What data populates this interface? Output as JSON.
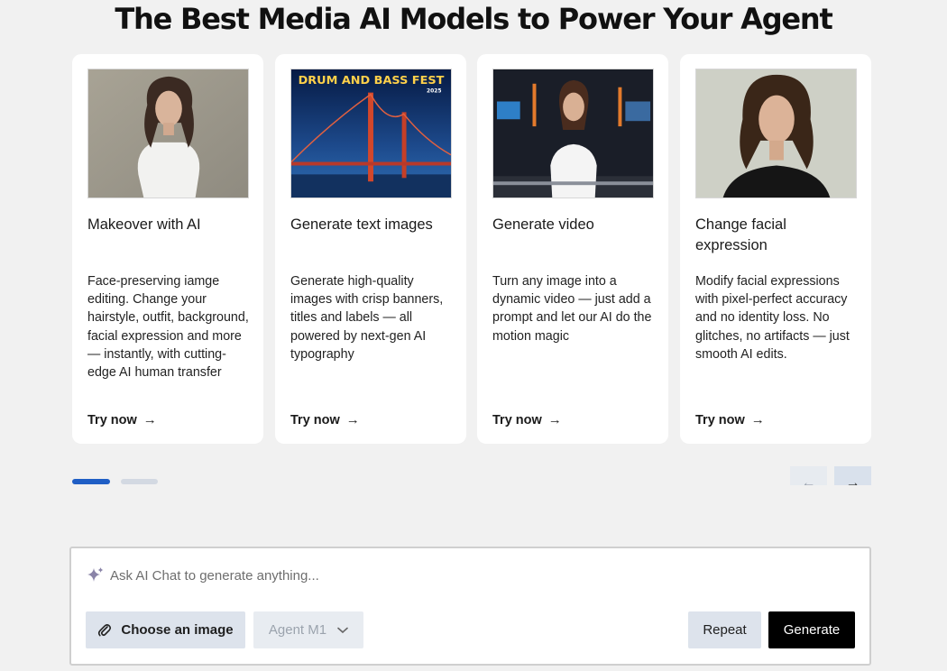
{
  "headline": "The Best Media AI Models to Power Your Agent",
  "cards": [
    {
      "title": "Makeover with AI",
      "description": "Face-preserving iamge editing. Change your hairstyle, outfit, background, facial expression and more — instantly, with cutting-edge AI human transfer",
      "cta": "Try now",
      "image": "woman-white-top-photo"
    },
    {
      "title": "Generate text images",
      "description": "Generate high-quality images with crisp banners, titles and labels — all powered by next-gen AI typography",
      "cta": "Try now",
      "image": "golden-gate-poster",
      "image_text": "DRUM AND BASS FEST",
      "image_subtext": "2025"
    },
    {
      "title": "Generate video",
      "description": "Turn any image into a dynamic video — just add a prompt and let our AI do the motion magic",
      "cta": "Try now",
      "image": "news-anchor-studio-photo"
    },
    {
      "title": "Change facial expression",
      "description": "Modify facial expressions with pixel-perfect accuracy and no identity loss. No glitches, no artifacts — just smooth AI edits.",
      "cta": "Try now",
      "image": "woman-smiling-portrait"
    }
  ],
  "carousel": {
    "active_page": 1,
    "page_count": 2,
    "prev_icon": "arrow-left-icon",
    "next_icon": "arrow-right-icon"
  },
  "prompt": {
    "placeholder": "Ask AI Chat to generate anything...",
    "choose_image_label": "Choose an image",
    "agent_label": "Agent M1",
    "repeat_label": "Repeat",
    "generate_label": "Generate"
  },
  "colors": {
    "accent": "#1f5ec5",
    "background": "#f1f1f1",
    "generate_button": "#000000"
  }
}
